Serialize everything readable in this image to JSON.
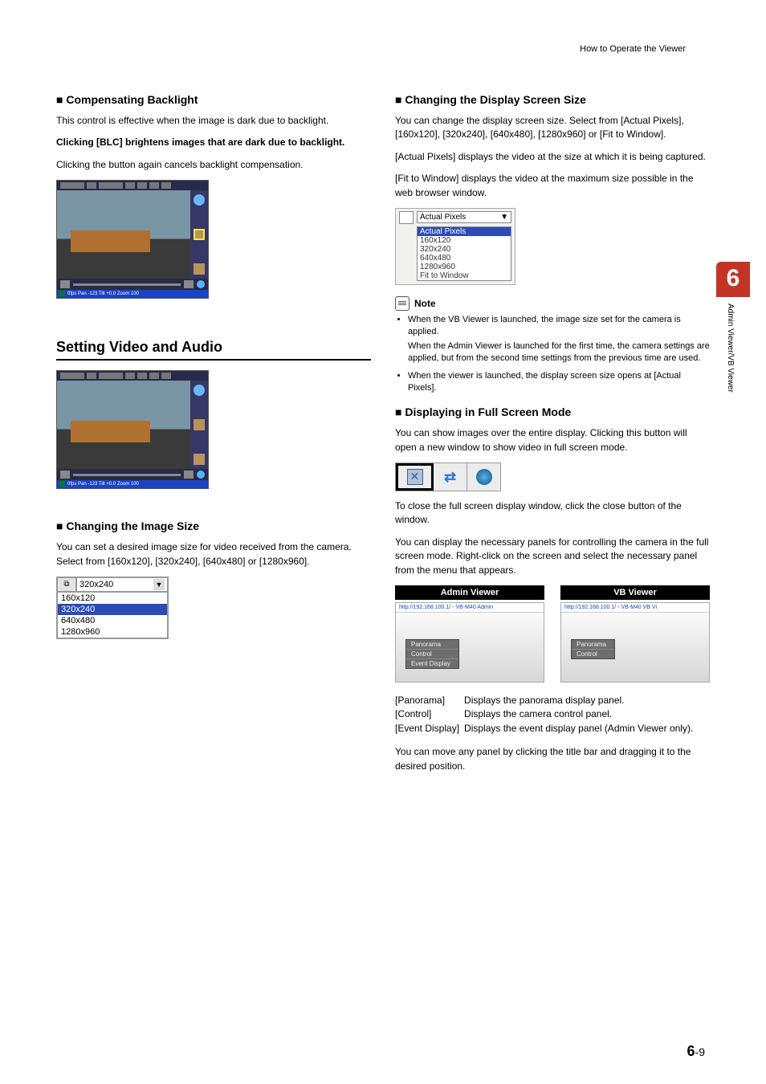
{
  "header": {
    "breadcrumb": "How to Operate the Viewer"
  },
  "chapter": {
    "number": "6",
    "label": "Admin Viewer/VB Viewer"
  },
  "footer": {
    "big": "6",
    "small": "-9"
  },
  "left": {
    "backlight": {
      "heading": "Compensating Backlight",
      "p1": "This control is effective when the image is dark due to backlight.",
      "p2": "Clicking [BLC] brightens images that are dark due to backlight.",
      "p3": "Clicking the button again cancels backlight compensation."
    },
    "av": {
      "heading": "Setting Video and Audio"
    },
    "imgsize": {
      "heading": "Changing the Image Size",
      "p1": "You can set a desired image size for video received from the camera. Select from [160x120], [320x240], [640x480] or [1280x960].",
      "dropdown": {
        "current": "320x240",
        "items": [
          "160x120",
          "320x240",
          "640x480",
          "1280x960"
        ],
        "selected_index": 1
      }
    }
  },
  "right": {
    "dispsize": {
      "heading": "Changing the Display Screen Size",
      "p1": "You can change the display screen size. Select from [Actual Pixels], [160x120], [320x240], [640x480], [1280x960] or [Fit to Window].",
      "p2": "[Actual Pixels] displays the video at the size at which it is being captured.",
      "p3": "[Fit to Window] displays the video at the maximum size possible in the web browser window.",
      "dropdown": {
        "current": "Actual Pixels",
        "items": [
          "Actual Pixels",
          "160x120",
          "320x240",
          "640x480",
          "1280x960",
          "Fit to Window"
        ],
        "selected_index": 0
      }
    },
    "note": {
      "label": "Note",
      "b1a": "When the VB Viewer is launched, the image size set for the camera is applied.",
      "b1b": "When the Admin Viewer is launched for the first time, the camera settings are applied, but from the second time settings from the previous time are used.",
      "b2": "When the viewer is launched, the display screen size opens at [Actual Pixels]."
    },
    "fullscreen": {
      "heading": "Displaying in Full Screen Mode",
      "p1": "You can show images over the entire display. Clicking this button will open a new window to show video in full screen mode.",
      "p2": "To close the full screen display window, click the close button of the window.",
      "p3": "You can display the necessary panels for controlling the camera in the full screen mode. Right-click on the screen and select the necessary panel from the menu that appears.",
      "panel_titles": {
        "admin": "Admin Viewer",
        "vb": "VB Viewer"
      },
      "urls": {
        "admin": "http://192.168.100.1/ - VB-M40 Admin",
        "vb": "http://192.168.100.1/ - VB-M40 VB Vi"
      },
      "menus": {
        "admin": [
          "Panorama",
          "Control",
          "Event Display"
        ],
        "vb": [
          "Panorama",
          "Control"
        ]
      },
      "defs": [
        {
          "k": "[Panorama]",
          "v": "Displays the panorama display panel."
        },
        {
          "k": "[Control]",
          "v": "Displays the camera control panel."
        },
        {
          "k": "[Event Display]",
          "v": "Displays the event display panel (Admin Viewer only)."
        }
      ],
      "p4": "You can move any panel by clicking the title bar and dragging it to the desired position."
    }
  },
  "viewer_status": "0fps Pan -123 Tilt +0.0 Zoom 100"
}
